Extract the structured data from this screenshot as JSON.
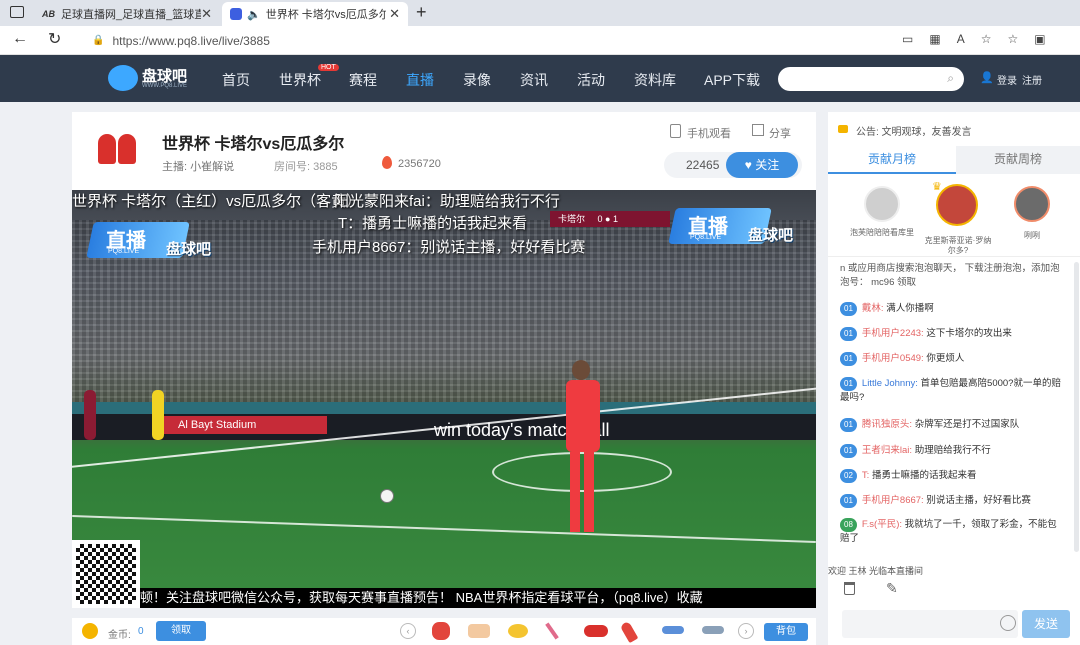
{
  "browser": {
    "tabs": [
      {
        "label": "足球直播网_足球直播_篮球直播..."
      },
      {
        "label": "世界杯 卡塔尔vs厄瓜多尔 -"
      }
    ],
    "url": "https://www.pq8.live/live/3885"
  },
  "site": {
    "logo_text": "盘球吧",
    "logo_sub": "WWW.PQ8.LIVE",
    "nav": [
      "首页",
      "世界杯",
      "赛程",
      "直播",
      "录像",
      "资讯",
      "活动",
      "资料库",
      "APP下载"
    ],
    "hot_badge": "HOT",
    "login": "登录",
    "register": "注册"
  },
  "room": {
    "title": "世界杯 卡塔尔vs厄瓜多尔",
    "host_label": "主播: 小崔解说",
    "room_no": "房间号: 3885",
    "heat": "2356720",
    "mobile_watch": "手机观看",
    "share": "分享",
    "followers": "22465",
    "follow_btn": "关注"
  },
  "video": {
    "danmaku": [
      "世界杯 卡塔尔（主红）vs厄瓜多尔（客黄）",
      "阳光蒙阳来fai：助理赔给我行不行",
      "T：播勇士嘛播的话我起来看",
      "手机用户8667：别说话主播，好好看比赛"
    ],
    "watermark_top": "直播",
    "watermark_sub": "PQ8.LIVE",
    "watermark_brand": "盘球吧",
    "score_home": "卡塔尔",
    "score": "0 ● 1",
    "ad_board": "Al Bayt Stadium",
    "ad_board2": "win today's match ball",
    "ticker": "顿！关注盘球吧微信公众号，获取每天赛事直播预告！  NBA世界杯指定看球平台，（pq8.live）收藏"
  },
  "bottom": {
    "coin_label": "金币:",
    "coin_value": "0",
    "claim_btn": "领取",
    "backpack_btn": "背包"
  },
  "sidebar": {
    "notice": "公告: 文明观球，友善发言",
    "tab_month": "贡献月榜",
    "tab_week": "贡献周榜",
    "ranks": [
      {
        "name": "泡芙陪陪陪看库里"
      },
      {
        "name": "克里斯蒂亚诺·罗纳尔多?"
      },
      {
        "name": "咧咧"
      }
    ],
    "system_msg": "n 或应用商店搜索泡泡聊天， 下载注册泡泡，添加泡泡号： mc96 领取",
    "messages": [
      {
        "level": "01",
        "user": "戴林:",
        "text": "满人你播啊"
      },
      {
        "level": "01",
        "user": "手机用户2243:",
        "text": "这下卡塔尔的攻出来"
      },
      {
        "level": "01",
        "user": "手机用户0549:",
        "text": "你更烦人"
      },
      {
        "level": "01",
        "user": "Little Johnny:",
        "text": "首单包赔最高陪5000?就一单的赔最吗?"
      },
      {
        "level": "01",
        "user": "腾讯独原头:",
        "text": "杂牌军还是打不过国家队"
      },
      {
        "level": "01",
        "user": "王者归来lai:",
        "text": "助理赔给我行不行"
      },
      {
        "level": "02",
        "user": "T:",
        "text": "播勇士嘛播的话我起来看"
      },
      {
        "level": "01",
        "user": "手机用户8667:",
        "text": "别说话主播，好好看比赛"
      },
      {
        "level": "08",
        "user": "F.s(平民):",
        "text": "我就坑了一千，领取了彩金，不能包赔了"
      }
    ],
    "welcome": "欢迎 王林 光临本直播间",
    "send_btn": "发送"
  }
}
